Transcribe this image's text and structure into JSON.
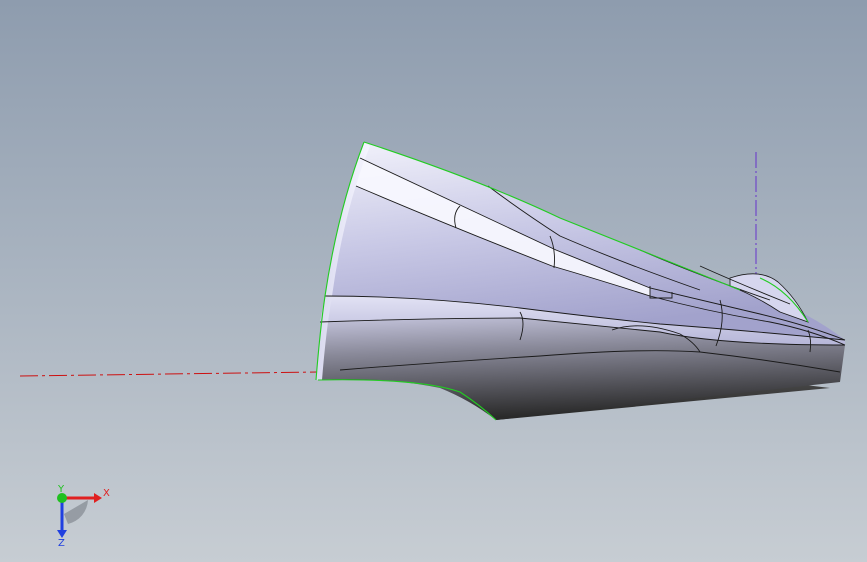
{
  "viewport": {
    "background_top": "#8e9cae",
    "background_bottom": "#c7cdd3"
  },
  "model": {
    "body_highlight": "#e6e6f6",
    "body_mid": "#b0b0d4",
    "body_shadow": "#3a3a3a",
    "edge_color": "#1a1a1a",
    "silhouette_color": "#22cc22"
  },
  "axes": {
    "x_axis_line_color": "#cc1111",
    "z_axis_line_color": "#6633cc"
  },
  "triad": {
    "x_label": "X",
    "y_label": "Y",
    "z_label": "Z",
    "x_color": "#e02020",
    "y_color": "#20c020",
    "z_color": "#2040e0"
  }
}
